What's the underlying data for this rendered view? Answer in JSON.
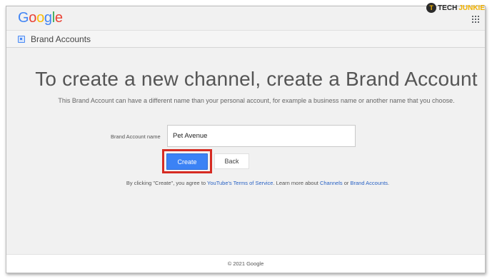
{
  "header": {
    "logo_letters": [
      {
        "char": "G",
        "color": "#4285F4"
      },
      {
        "char": "o",
        "color": "#EA4335"
      },
      {
        "char": "o",
        "color": "#FBBC05"
      },
      {
        "char": "g",
        "color": "#4285F4"
      },
      {
        "char": "l",
        "color": "#34A853"
      },
      {
        "char": "e",
        "color": "#EA4335"
      }
    ],
    "apps_icon": "apps-grid-icon"
  },
  "watermark": {
    "badge": "T",
    "part1": "TECH",
    "part2": "JUNKIE"
  },
  "subbar": {
    "title": "Brand Accounts",
    "icon": "brand-account-icon"
  },
  "main": {
    "headline": "To create a new channel, create a Brand Account",
    "subtext": "This Brand Account can have a different name than your personal account, for example a business name or another name that you choose.",
    "field_label": "Brand Account name",
    "field_value": "Pet Avenue",
    "create_label": "Create",
    "back_label": "Back",
    "terms": {
      "prefix": "By clicking \"Create\", you agree to ",
      "tos_link": "YouTube's Terms of Service",
      "middle": ". Learn more about ",
      "channels_link": "Channels",
      "or": " or ",
      "brand_link": "Brand Accounts",
      "suffix": "."
    }
  },
  "footer": {
    "copyright": "© 2021 Google"
  },
  "colors": {
    "primary_button": "#3b82f5",
    "highlight": "#d62b22",
    "link": "#2962c4"
  }
}
